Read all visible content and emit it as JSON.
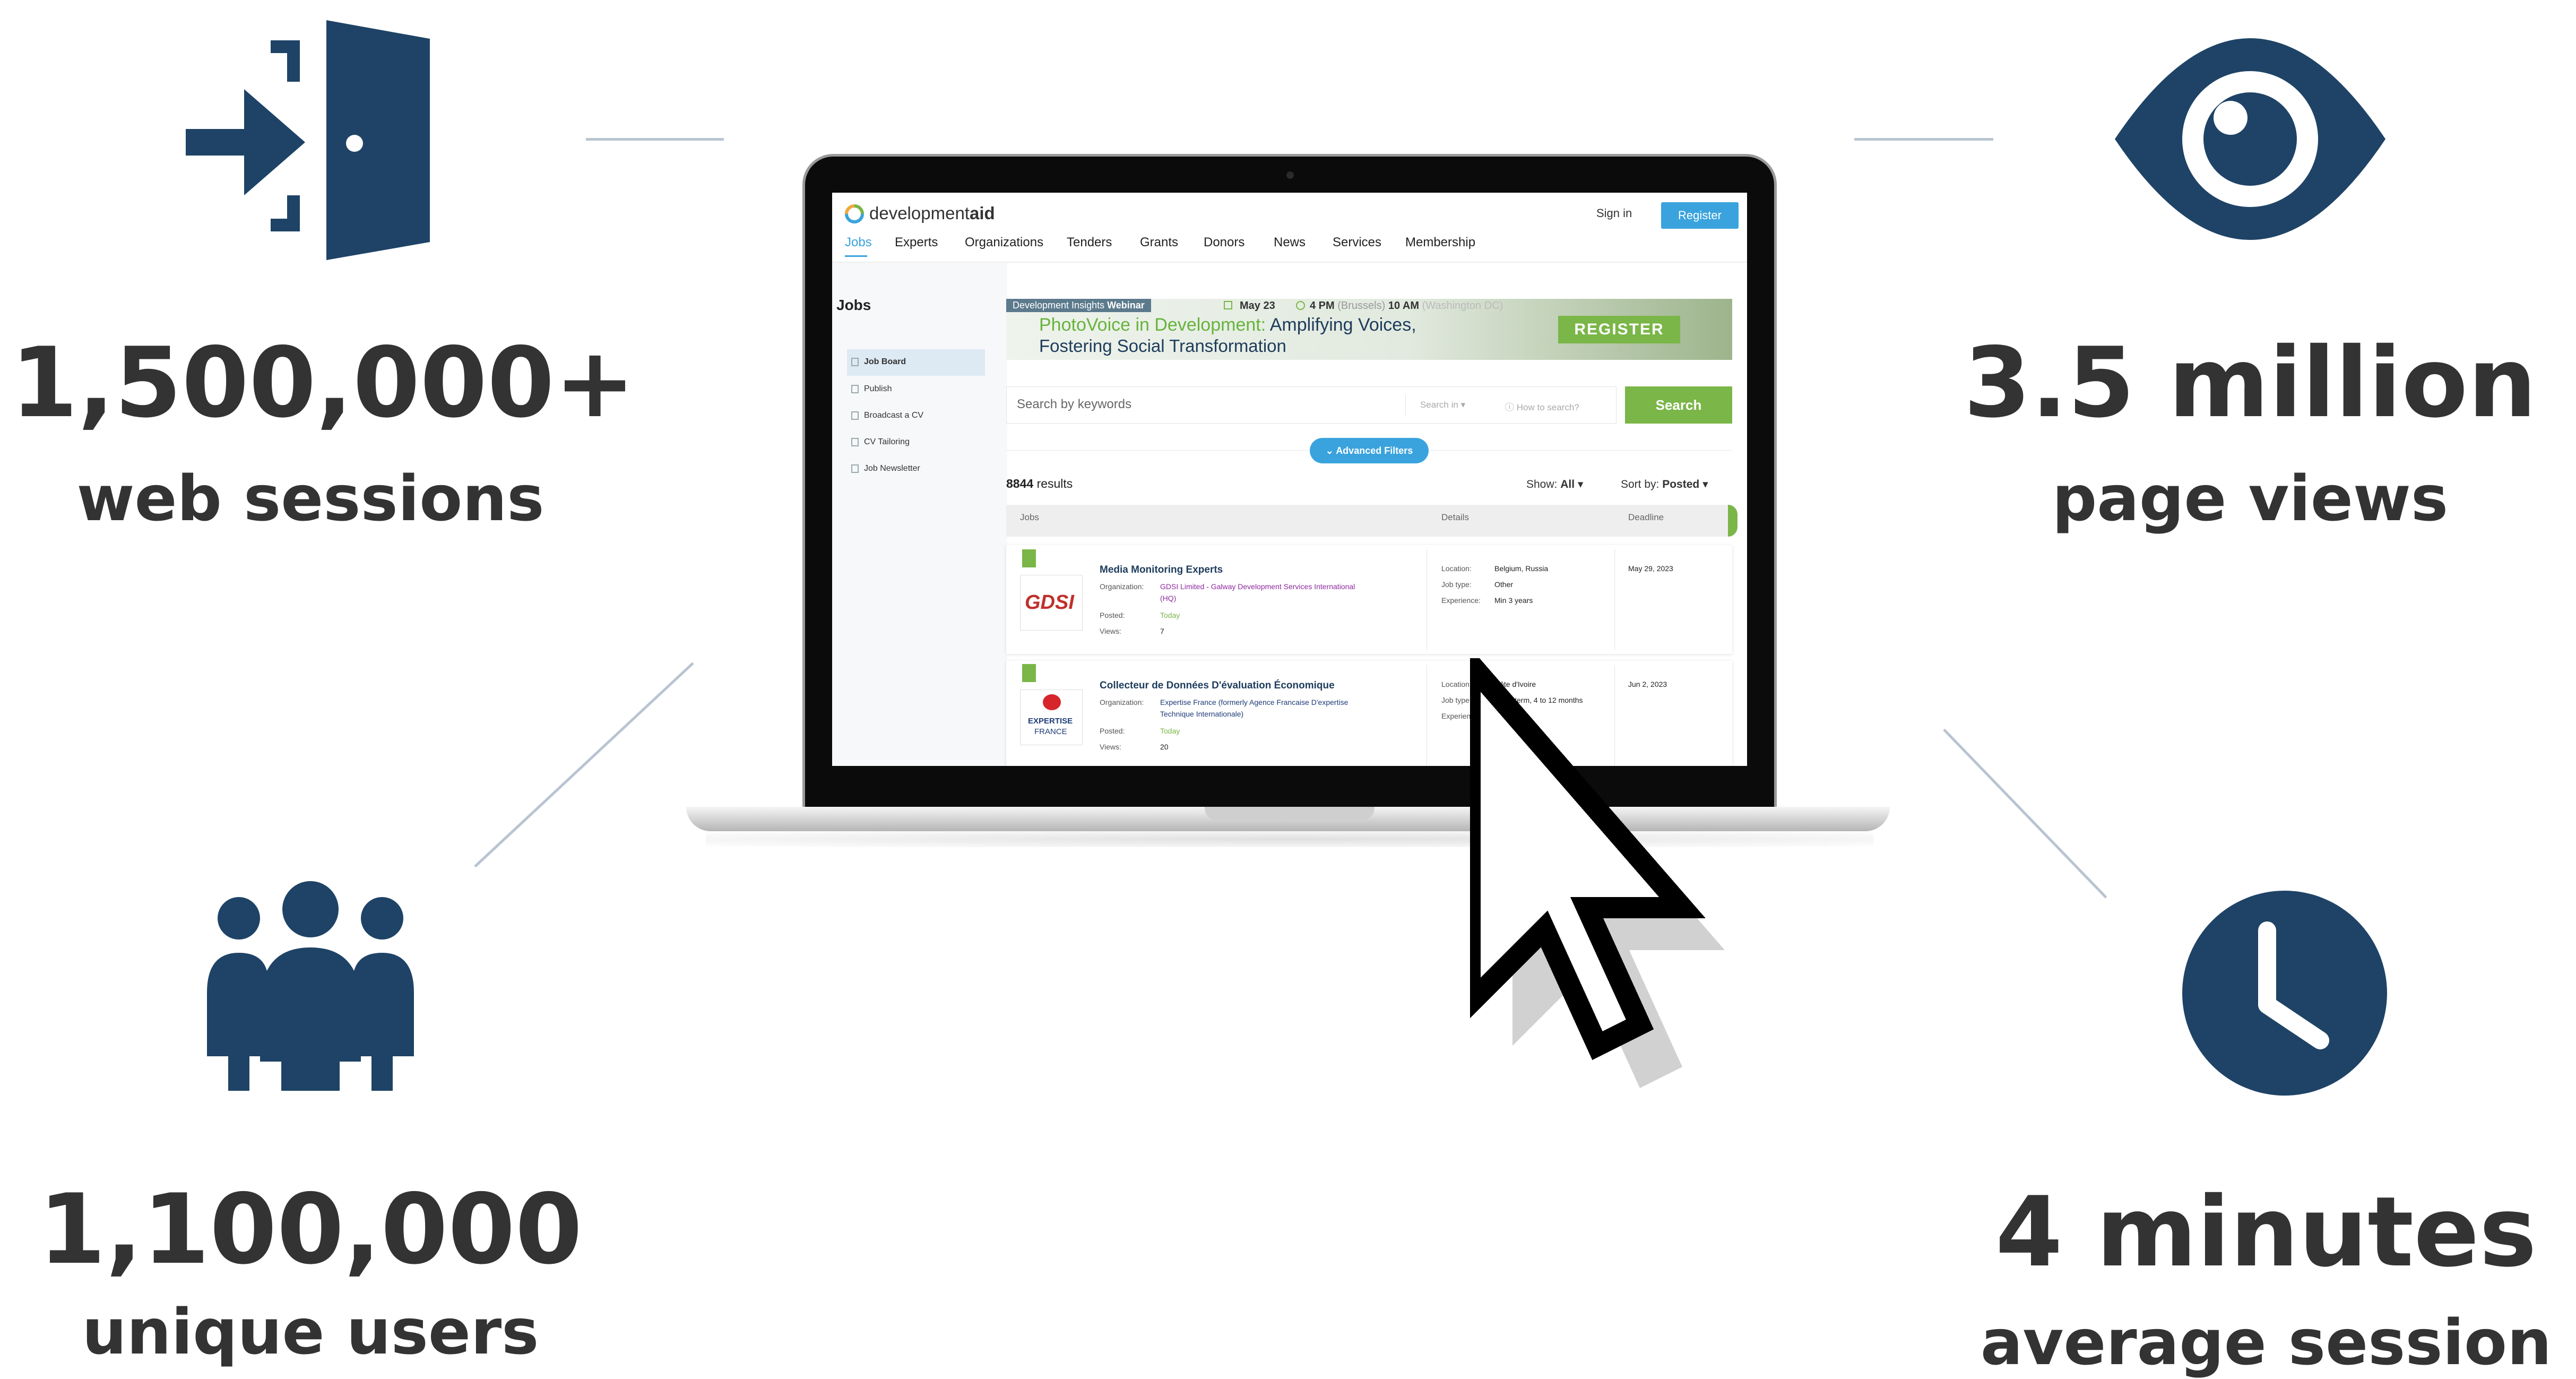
{
  "stats": {
    "top_left": {
      "number": "1,500,000+",
      "label": "web sessions",
      "icon": "door-enter-icon"
    },
    "top_right": {
      "number": "3.5 million",
      "label": "page views",
      "icon": "eye-icon"
    },
    "bottom_left": {
      "number": "1,100,000",
      "label": "unique users",
      "icon": "users-group-icon"
    },
    "bottom_right": {
      "number": "4 minutes",
      "label": "average session",
      "icon": "clock-icon"
    }
  },
  "colors": {
    "icon": "#1e4366",
    "text": "#333333",
    "brand_blue": "#3aa3dd",
    "brand_green": "#7ab648"
  },
  "site": {
    "logo_text_1": "development",
    "logo_text_2": "aid",
    "sign_in": "Sign in",
    "register": "Register",
    "nav": [
      "Jobs",
      "Experts",
      "Organizations",
      "Tenders",
      "Grants",
      "Donors",
      "News",
      "Services",
      "Membership"
    ],
    "sidebar_title": "Jobs",
    "sidebar_items": [
      "Job Board",
      "Publish",
      "Broadcast a CV",
      "CV Tailoring",
      "Job Newsletter"
    ],
    "banner": {
      "tag1": "Development Insights",
      "tag2": "Webinar",
      "date": "May 23",
      "time1": "4 PM",
      "tz1": "(Brussels)",
      "time2": "10 AM",
      "tz2": "(Washington DC)",
      "headline_1a": "PhotoVoice in Development:",
      "headline_1b": "Amplifying Voices,",
      "headline_2": "Fostering Social Transformation",
      "cta": "REGISTER"
    },
    "search": {
      "placeholder": "Search by keywords",
      "search_in": "Search in",
      "how_to": "How to search?",
      "button": "Search",
      "advanced": "Advanced Filters"
    },
    "results": {
      "count": "8844",
      "label": "results",
      "show_label": "Show:",
      "show_value": "All",
      "sort_label": "Sort by:",
      "sort_value": "Posted"
    },
    "table_headers": [
      "Jobs",
      "Details",
      "Deadline"
    ],
    "jobs": [
      {
        "logo": "GDSI",
        "title": "Media Monitoring Experts",
        "org_label": "Organization:",
        "org_1": "GDSI Limited - Galway Development Services International",
        "org_2": "(HQ)",
        "posted_label": "Posted:",
        "posted": "Today",
        "views_label": "Views:",
        "views": "7",
        "location_label": "Location:",
        "location": "Belgium, Russia",
        "jobtype_label": "Job type:",
        "jobtype": "Other",
        "experience_label": "Experience:",
        "experience": "Min 3 years",
        "deadline": "May 29, 2023"
      },
      {
        "logo_1": "EXPERTISE",
        "logo_2": "FRANCE",
        "title": "Collecteur de Données D'évaluation Économique",
        "org_label": "Organization:",
        "org_1": "Expertise France (formerly Agence Francaise D'expertise",
        "org_2": "Technique Internationale)",
        "posted_label": "Posted:",
        "posted": "Today",
        "views_label": "Views:",
        "views": "20",
        "location_label": "Location:",
        "location": "Côte d'Ivoire",
        "jobtype_label": "Job type:",
        "jobtype": "Short-term, 4 to 12 months",
        "experience_label": "Experience:",
        "deadline": "Jun 2, 2023"
      }
    ]
  }
}
